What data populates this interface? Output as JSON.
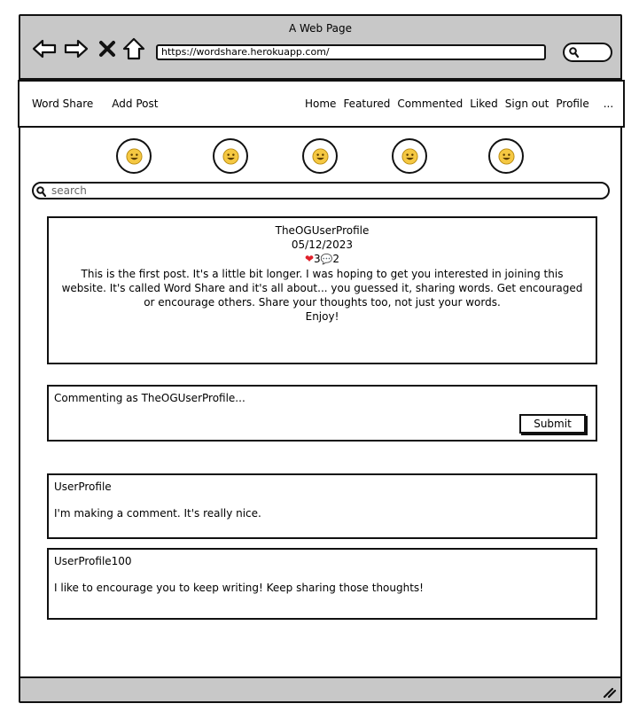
{
  "window": {
    "title": "A Web Page"
  },
  "browser": {
    "url": "https://wordshare.herokuapp.com/",
    "icons": [
      "back-arrow-icon",
      "forward-arrow-icon",
      "close-x-icon",
      "home-icon",
      "search-icon"
    ]
  },
  "navbar": {
    "brand": "Word Share",
    "add_post": "Add Post",
    "links": [
      "Home",
      "Featured",
      "Commented",
      "Liked",
      "Sign out",
      "Profile",
      "..."
    ]
  },
  "avatars": {
    "count": 5,
    "icon": "smiley-face-icon"
  },
  "search": {
    "placeholder": "search"
  },
  "post": {
    "author": "TheOGUserProfile",
    "date": "05/12/2023",
    "likes": "3",
    "comments": "2",
    "body": "This is the first post. It's a little bit longer. I was hoping to get you interested in joining this website. It's called Word Share and it's all about... you guessed it, sharing words. Get encouraged or encourage others. Share your thoughts too, not just your words.",
    "closing": "Enjoy!"
  },
  "comment_form": {
    "label": "Commenting as TheOGUserProfile...",
    "submit_label": "Submit"
  },
  "comments": [
    {
      "author": "UserProfile",
      "text": "I'm making a comment. It's really nice."
    },
    {
      "author": "UserProfile100",
      "text": "I like to encourage you to keep writing! Keep sharing those thoughts!"
    }
  ],
  "colors": {
    "chrome": "#c8c8c8",
    "heart": "#e0202a",
    "smiley": "#f5c842"
  }
}
